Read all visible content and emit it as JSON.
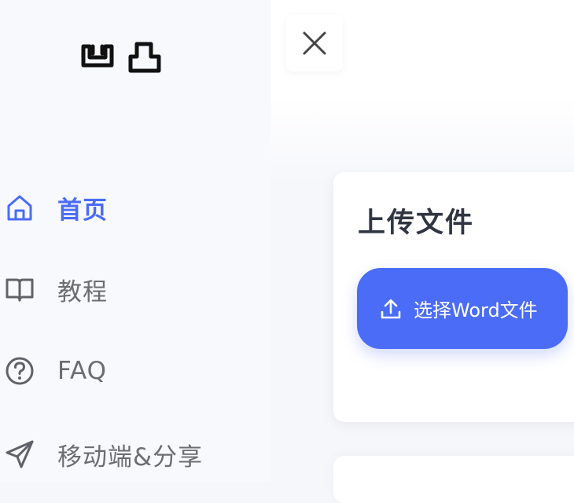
{
  "logo": {
    "icon": "logo-icon"
  },
  "nav": {
    "items": [
      {
        "label": "首页",
        "icon": "home-icon",
        "active": true
      },
      {
        "label": "教程",
        "icon": "book-icon",
        "active": false
      },
      {
        "label": "FAQ",
        "icon": "question-circle-icon",
        "active": false
      },
      {
        "label": "移动端&分享",
        "icon": "send-icon",
        "active": false
      }
    ]
  },
  "header": {
    "close_icon": "close-icon"
  },
  "upload": {
    "title": "上传文件",
    "button_label": "选择Word文件",
    "button_icon": "upload-icon"
  },
  "colors": {
    "accent": "#4a6cf7",
    "sidebar_bg": "#f8f9fc",
    "text_muted": "#6b6d73",
    "title": "#2f3542"
  }
}
